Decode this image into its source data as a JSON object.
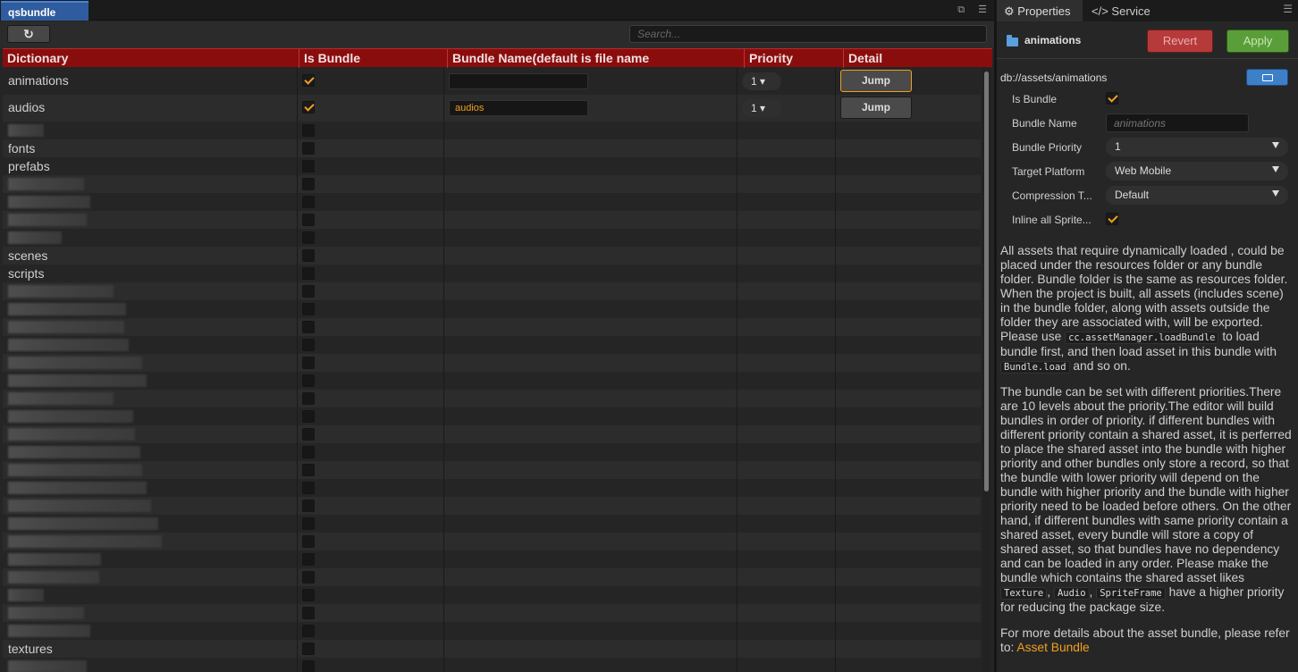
{
  "left_panel": {
    "tab_title": "qsbundle",
    "search_placeholder": "Search...",
    "columns": [
      "Dictionary",
      "Is Bundle",
      "Bundle Name(default is file name",
      "Priority",
      "Detail"
    ],
    "rows": [
      {
        "name": "animations",
        "is_bundle": true,
        "bundle_name": "",
        "priority": "1",
        "detail": "Jump",
        "focused": true
      },
      {
        "name": "audios",
        "is_bundle": true,
        "bundle_name": "audios",
        "priority": "1",
        "detail": "Jump",
        "focused": false
      },
      {
        "name": "",
        "blurred": true,
        "is_bundle": false
      },
      {
        "name": "fonts",
        "is_bundle": false
      },
      {
        "name": "prefabs",
        "is_bundle": false
      },
      {
        "name": "",
        "blurred": true,
        "is_bundle": false
      },
      {
        "name": "",
        "blurred": true,
        "is_bundle": false
      },
      {
        "name": "",
        "blurred": true,
        "is_bundle": false
      },
      {
        "name": "",
        "blurred": true,
        "is_bundle": false
      },
      {
        "name": "scenes",
        "is_bundle": false
      },
      {
        "name": "scripts",
        "is_bundle": false
      },
      {
        "name": "",
        "blurred": true,
        "is_bundle": false
      },
      {
        "name": "",
        "blurred": true,
        "is_bundle": false
      },
      {
        "name": "",
        "blurred": true,
        "is_bundle": false
      },
      {
        "name": "",
        "blurred": true,
        "is_bundle": false
      },
      {
        "name": "",
        "blurred": true,
        "is_bundle": false
      },
      {
        "name": "",
        "blurred": true,
        "is_bundle": false
      },
      {
        "name": "",
        "blurred": true,
        "is_bundle": false
      },
      {
        "name": "",
        "blurred": true,
        "is_bundle": false
      },
      {
        "name": "",
        "blurred": true,
        "is_bundle": false
      },
      {
        "name": "",
        "blurred": true,
        "is_bundle": false
      },
      {
        "name": "",
        "blurred": true,
        "is_bundle": false
      },
      {
        "name": "",
        "blurred": true,
        "is_bundle": false
      },
      {
        "name": "",
        "blurred": true,
        "is_bundle": false
      },
      {
        "name": "",
        "blurred": true,
        "is_bundle": false
      },
      {
        "name": "",
        "blurred": true,
        "is_bundle": false
      },
      {
        "name": "",
        "blurred": true,
        "is_bundle": false
      },
      {
        "name": "",
        "blurred": true,
        "is_bundle": false
      },
      {
        "name": "",
        "blurred": true,
        "is_bundle": false
      },
      {
        "name": "",
        "blurred": true,
        "is_bundle": false
      },
      {
        "name": "",
        "blurred": true,
        "is_bundle": false
      },
      {
        "name": "textures",
        "is_bundle": false
      },
      {
        "name": "",
        "blurred": true,
        "is_bundle": false
      }
    ]
  },
  "right_panel": {
    "tabs": [
      {
        "label": "Properties",
        "active": true
      },
      {
        "label": "Service",
        "active": false
      }
    ],
    "asset_name": "animations",
    "revert_label": "Revert",
    "apply_label": "Apply",
    "asset_path": "db://assets/animations",
    "props": {
      "is_bundle_label": "Is Bundle",
      "bundle_name_label": "Bundle Name",
      "bundle_name_placeholder": "animations",
      "bundle_priority_label": "Bundle Priority",
      "bundle_priority_value": "1",
      "target_platform_label": "Target Platform",
      "target_platform_value": "Web Mobile",
      "compression_label": "Compression T...",
      "compression_value": "Default",
      "inline_label": "Inline all Sprite..."
    },
    "desc1_a": "All assets that require dynamically loaded , could be placed under the resources folder or any bundle folder. Bundle folder is the same as resources folder. When the project is built, all assets (includes scene) in the bundle folder, along with assets outside the folder they are associated with, will be exported. Please use ",
    "desc1_code1": "cc.assetManager.loadBundle",
    "desc1_b": " to load bundle first, and then load asset in this bundle with ",
    "desc1_code2": "Bundle.load",
    "desc1_c": " and so on.",
    "desc2_a": "The bundle can be set with different priorities.There are 10 levels about the priority.The editor will build bundles in order of priority. if different bundles with different priority contain a shared asset, it is perferred to place the shared asset into the bundle with higher priority and other bundles only store a record, so that the bundle with lower priority will depend on the bundle with higher priority and the bundle with higher priority need to be loaded before others. On the other hand, if different bundles with same priority contain a shared asset, every bundle will store a copy of shared asset, so that bundles have no dependency and can be loaded in any order. Please make the bundle which contains the shared asset likes ",
    "desc2_code1": "Texture",
    "desc2_sep1": ", ",
    "desc2_code2": "Audio",
    "desc2_sep2": ", ",
    "desc2_code3": "SpriteFrame",
    "desc2_b": " have a higher priority for reducing the package size.",
    "desc3_a": "For more details about the asset bundle, please refer to: ",
    "desc3_link": "Asset Bundle"
  },
  "colors": {
    "accent_orange": "#f0a020",
    "header_red": "#8a0d0d",
    "tab_blue": "#2f5c9e",
    "revert_red": "#b73a3a",
    "apply_green": "#5a9e3a"
  }
}
